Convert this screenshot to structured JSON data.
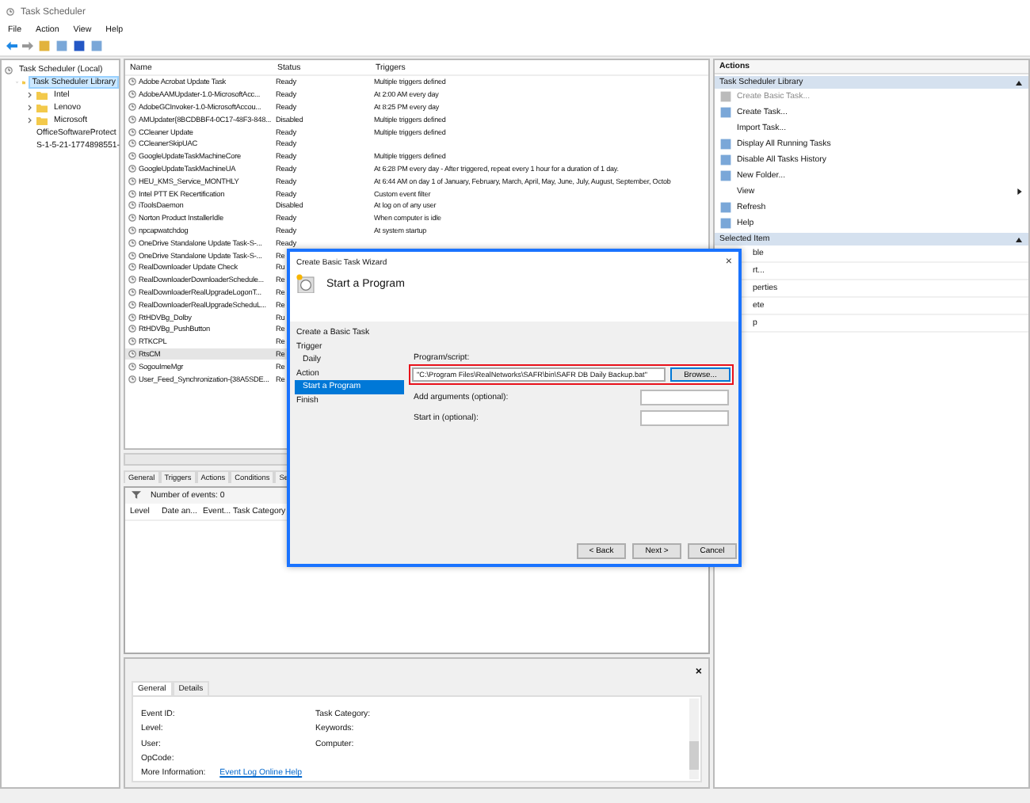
{
  "window": {
    "title": "Task Scheduler"
  },
  "menu": [
    "File",
    "Action",
    "View",
    "Help"
  ],
  "tree": {
    "label": "Task Scheduler (Local)",
    "children": [
      {
        "label": "Task Scheduler Library",
        "selected": true,
        "kind": "expanded",
        "children": [
          {
            "label": "Intel",
            "selected": false,
            "kind": "collapsed"
          },
          {
            "label": "Lenovo",
            "selected": false,
            "kind": "collapsed"
          },
          {
            "label": "Microsoft",
            "selected": false,
            "kind": "collapsed"
          },
          {
            "label": "OfficeSoftwareProtect",
            "selected": false,
            "kind": "leaf"
          },
          {
            "label": "S-1-5-21-1774898551-",
            "selected": false,
            "kind": "leaf"
          }
        ]
      }
    ]
  },
  "table": {
    "columns": [
      "Name",
      "Status",
      "Triggers"
    ],
    "rows": [
      {
        "name": "Adobe Acrobat Update Task",
        "status": "Ready",
        "trigger": "Multiple triggers defined",
        "selected": false
      },
      {
        "name": "AdobeAAMUpdater-1.0-MicrosoftAcc...",
        "status": "Ready",
        "trigger": "At 2:00 AM every day",
        "selected": false
      },
      {
        "name": "AdobeGCInvoker-1.0-MicrosoftAccou...",
        "status": "Ready",
        "trigger": "At 8:25 PM every day",
        "selected": false
      },
      {
        "name": "AMUpdater{8BCDBBF4-0C17-48F3-848...",
        "status": "Disabled",
        "trigger": "Multiple triggers defined",
        "selected": false
      },
      {
        "name": "CCleaner Update",
        "status": "Ready",
        "trigger": "Multiple triggers defined",
        "selected": false
      },
      {
        "name": "CCleanerSkipUAC",
        "status": "Ready",
        "selected": false
      },
      {
        "name": "GoogleUpdateTaskMachineCore",
        "status": "Ready",
        "trigger": "Multiple triggers defined",
        "selected": false
      },
      {
        "name": "GoogleUpdateTaskMachineUA",
        "status": "Ready",
        "trigger": "At 6:28 PM every day - After triggered, repeat every 1 hour for a duration of 1 day.",
        "selected": false
      },
      {
        "name": "HEU_KMS_Service_MONTHLY",
        "status": "Ready",
        "trigger": "At 6:44 AM on day 1 of January, February, March, April, May, June, July, August, September, Octob",
        "selected": false
      },
      {
        "name": "Intel PTT EK Recertification",
        "status": "Ready",
        "trigger": "Custom event filter",
        "selected": false
      },
      {
        "name": "iToolsDaemon",
        "status": "Disabled",
        "trigger": "At log on of any user",
        "selected": false
      },
      {
        "name": "Norton Product InstallerIdle",
        "status": "Ready",
        "trigger": "When computer is idle",
        "selected": false
      },
      {
        "name": "npcapwatchdog",
        "status": "Ready",
        "trigger": "At system startup",
        "selected": false
      },
      {
        "name": "OneDrive Standalone Update Task-S-...",
        "status": "Ready",
        "selected": false
      },
      {
        "name": "OneDrive Standalone Update Task-S-...",
        "status": "Re",
        "selected": false
      },
      {
        "name": "RealDownloader Update Check",
        "status": "Ru",
        "selected": false
      },
      {
        "name": "RealDownloaderDownloaderSchedule...",
        "status": "Re",
        "selected": false
      },
      {
        "name": "RealDownloaderRealUpgradeLogonT...",
        "status": "Re",
        "selected": false
      },
      {
        "name": "RealDownloaderRealUpgradeScheduL...",
        "status": "Re",
        "selected": false
      },
      {
        "name": "RtHDVBg_Dolby",
        "status": "Ru",
        "selected": false
      },
      {
        "name": "RtHDVBg_PushButton",
        "status": "Re",
        "selected": false
      },
      {
        "name": "RTKCPL",
        "status": "Re",
        "selected": false
      },
      {
        "name": "RtsCM",
        "status": "Re",
        "selected": true
      },
      {
        "name": "SogouImeMgr",
        "status": "Re",
        "selected": false
      },
      {
        "name": "User_Feed_Synchronization-{38A5SDE...",
        "status": "Re",
        "selected": false
      }
    ]
  },
  "task_tabs": [
    {
      "label": "General",
      "selected": false
    },
    {
      "label": "Triggers",
      "selected": false
    },
    {
      "label": "Actions",
      "selected": false
    },
    {
      "label": "Conditions",
      "selected": false
    },
    {
      "label": "Se",
      "selected": false
    }
  ],
  "events": {
    "count": "Number of events: 0",
    "columns": [
      "Level",
      "Date an...",
      "Event...",
      "Task Category"
    ]
  },
  "event_details": {
    "close": "×",
    "tabs": [
      {
        "label": "General",
        "selected": true
      },
      {
        "label": "Details",
        "selected": false
      }
    ],
    "left_fields": [
      "Event ID:",
      "Level:",
      "User:",
      "OpCode:"
    ],
    "right_fields": [
      "Task Category:",
      "Keywords:",
      "Computer:"
    ],
    "more_info_label": "More Information:",
    "more_info_link": "Event Log Online Help"
  },
  "actions": {
    "title": "Actions",
    "sections": [
      {
        "title": "Task Scheduler Library",
        "expanded": true,
        "items": [
          {
            "label": "Create Basic Task...",
            "kind": "command",
            "disabled": true
          },
          {
            "label": "Create Task...",
            "kind": "command",
            "disabled": false
          },
          {
            "label": "Import Task...",
            "kind": "plain",
            "disabled": false
          },
          {
            "label": "Display All Running Tasks",
            "kind": "command",
            "disabled": false
          },
          {
            "label": "Disable All Tasks History",
            "kind": "command",
            "disabled": false
          },
          {
            "label": "New Folder...",
            "kind": "command",
            "disabled": false
          },
          {
            "label": "View",
            "kind": "submenu",
            "disabled": false
          },
          {
            "label": "Refresh",
            "kind": "command",
            "disabled": false
          },
          {
            "label": "Help",
            "kind": "command",
            "disabled": false
          }
        ]
      },
      {
        "title": "Selected Item",
        "expanded": true,
        "items": [
          {
            "label": "ble",
            "kind": "partial",
            "disabled": false
          },
          {
            "label": "rt...",
            "kind": "partial",
            "disabled": false
          },
          {
            "label": "perties",
            "kind": "partial",
            "disabled": false
          },
          {
            "label": "ete",
            "kind": "partial",
            "disabled": false
          },
          {
            "label": "p",
            "kind": "partial",
            "disabled": false
          }
        ]
      }
    ]
  },
  "dialog": {
    "title": "Create Basic Task Wizard",
    "close": "×",
    "heading": "Start a Program",
    "steps": [
      {
        "label": "Create a Basic Task",
        "kind": "header",
        "selected": false
      },
      {
        "label": "Trigger",
        "kind": "step",
        "selected": false
      },
      {
        "label": "Daily",
        "kind": "substep",
        "selected": false
      },
      {
        "label": "Action",
        "kind": "step",
        "selected": false
      },
      {
        "label": "Start a Program",
        "kind": "substep",
        "selected": true
      },
      {
        "label": "Finish",
        "kind": "step",
        "selected": false
      }
    ],
    "program_label": "Program/script:",
    "program_value": "\"C:\\Program Files\\RealNetworks\\SAFR\\bin\\SAFR DB Daily Backup.bat\"",
    "browse": "Browse...",
    "highlighted": true,
    "fields": [
      {
        "label": "Add arguments (optional):"
      },
      {
        "label": "Start in (optional):"
      }
    ],
    "buttons": [
      "< Back",
      "Next >",
      "Cancel"
    ]
  }
}
